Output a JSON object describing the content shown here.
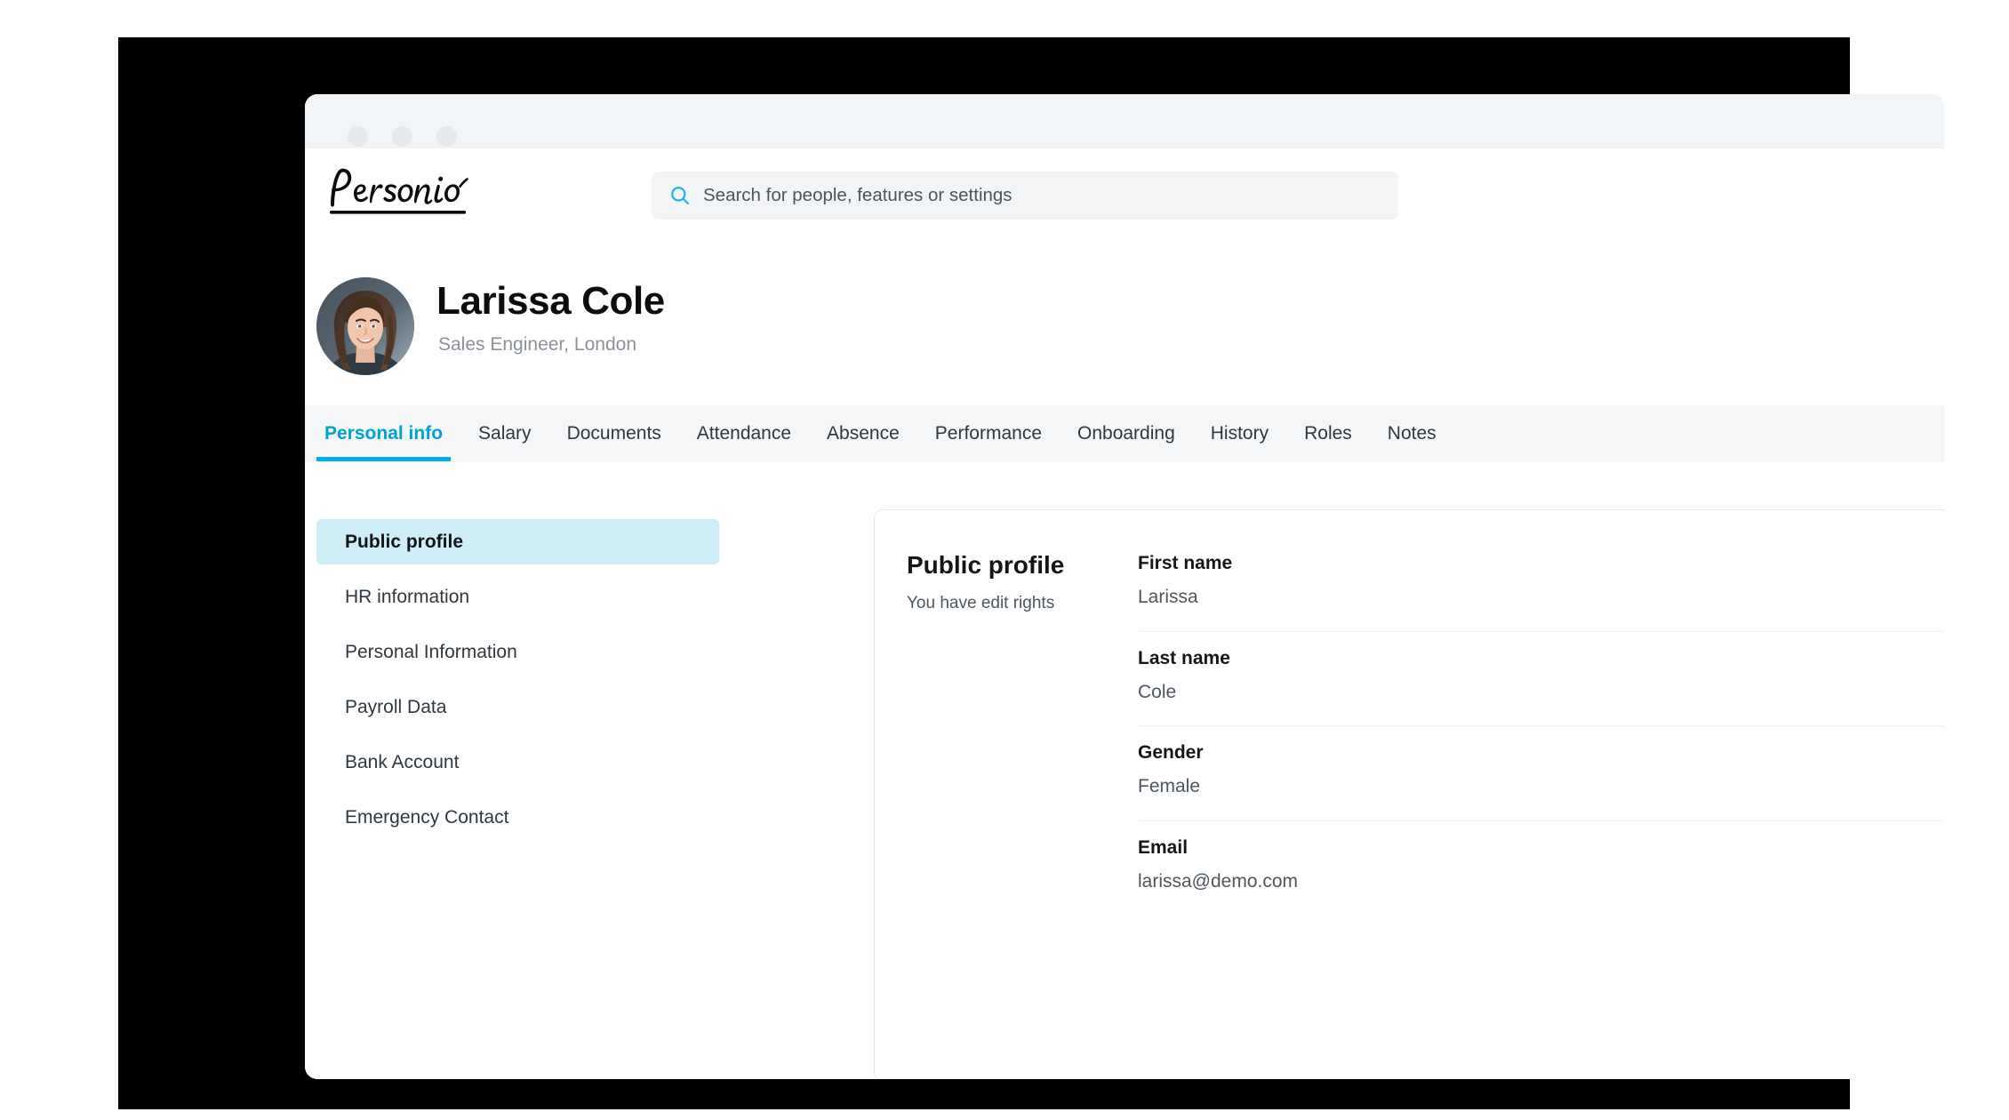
{
  "window": {
    "titlebar_dots": [
      "dot-red",
      "dot-yellow",
      "dot-green"
    ]
  },
  "brand": {
    "logo_text": "Personio",
    "accent_color": "#00aee0",
    "highlight_color": "#cdeef6"
  },
  "search": {
    "icon": "search-icon",
    "placeholder": "Search for people, features or settings",
    "value": ""
  },
  "profile": {
    "name": "Larissa Cole",
    "subtitle": "Sales Engineer, London",
    "avatar_alt": "Larissa Cole profile photo"
  },
  "tabs": [
    {
      "label": "Personal info",
      "active": true
    },
    {
      "label": "Salary",
      "active": false
    },
    {
      "label": "Documents",
      "active": false
    },
    {
      "label": "Attendance",
      "active": false
    },
    {
      "label": "Absence",
      "active": false
    },
    {
      "label": "Performance",
      "active": false
    },
    {
      "label": "Onboarding",
      "active": false
    },
    {
      "label": "History",
      "active": false
    },
    {
      "label": "Roles",
      "active": false
    },
    {
      "label": "Notes",
      "active": false
    }
  ],
  "sidebar": {
    "items": [
      {
        "label": "Public profile",
        "active": true
      },
      {
        "label": "HR information",
        "active": false
      },
      {
        "label": "Personal Information",
        "active": false
      },
      {
        "label": "Payroll Data",
        "active": false
      },
      {
        "label": "Bank Account",
        "active": false
      },
      {
        "label": "Emergency Contact",
        "active": false
      }
    ]
  },
  "card": {
    "title": "Public profile",
    "subtitle": "You have edit rights",
    "fields": [
      {
        "label": "First name",
        "value": "Larissa"
      },
      {
        "label": "Last name",
        "value": "Cole"
      },
      {
        "label": "Gender",
        "value": "Female"
      },
      {
        "label": "Email",
        "value": "larissa@demo.com"
      }
    ]
  }
}
